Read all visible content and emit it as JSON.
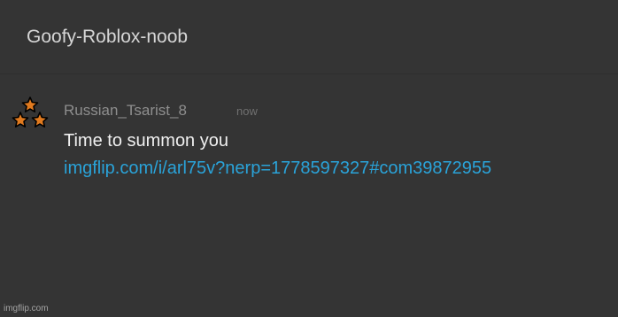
{
  "header": {
    "title": "Goofy-Roblox-noob"
  },
  "comment": {
    "username": "Russian_Tsarist_8",
    "timestamp": "now",
    "avatar_icon": "three-stars-icon",
    "text": "Time to summon you",
    "link": "imgflip.com/i/arl75v?nerp=1778597327#com39872955"
  },
  "watermark": "imgflip.com",
  "colors": {
    "background": "#343434",
    "link": "#2aa3d9",
    "star_fill": "#e07a1f"
  }
}
